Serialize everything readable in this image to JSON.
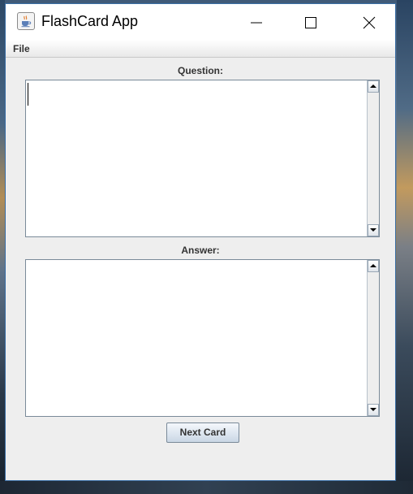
{
  "window": {
    "title": "FlashCard App",
    "icon": "java-cup-icon"
  },
  "menubar": {
    "items": [
      "File"
    ]
  },
  "question": {
    "label": "Question:",
    "value": ""
  },
  "answer": {
    "label": "Answer:",
    "value": ""
  },
  "actions": {
    "next_label": "Next Card"
  },
  "colors": {
    "window_border": "#3a6ea5",
    "panel_bg": "#eeeeee",
    "field_border": "#7a8a99"
  }
}
